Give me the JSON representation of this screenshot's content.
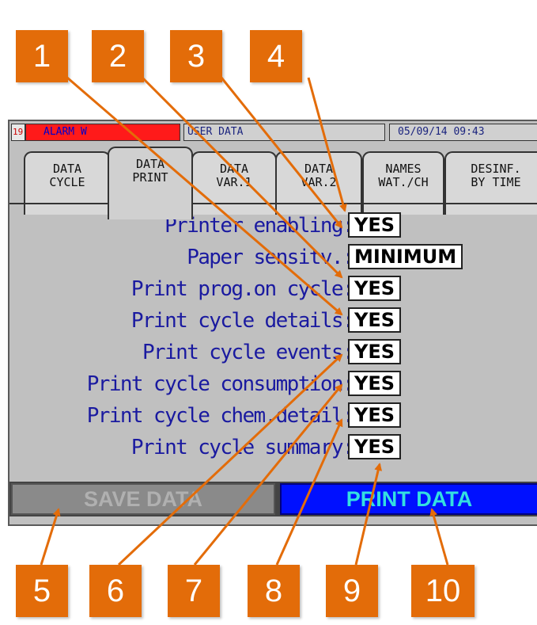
{
  "callouts": [
    "1",
    "2",
    "3",
    "4",
    "5",
    "6",
    "7",
    "8",
    "9",
    "10"
  ],
  "header": {
    "alarm_number": "19",
    "alarm_text": "ALARM W",
    "title": "USER DATA",
    "datetime": "05/09/14  09:43"
  },
  "tabs": [
    {
      "line1": "DATA",
      "line2": "CYCLE",
      "active": false
    },
    {
      "line1": "DATA",
      "line2": "PRINT",
      "active": true
    },
    {
      "line1": "DATA",
      "line2": "VAR.1",
      "active": false
    },
    {
      "line1": "DATA",
      "line2": "VAR.2",
      "active": false
    },
    {
      "line1": "NAMES",
      "line2": "WAT./CH",
      "active": false
    },
    {
      "line1": "DESINF.",
      "line2": "BY TIME",
      "active": false
    }
  ],
  "fields": [
    {
      "label": "Printer enabling:",
      "value": "YES"
    },
    {
      "label": "Paper sensitv.:",
      "value": "MINIMUM"
    },
    {
      "label": "Print prog.on cycle:",
      "value": "YES"
    },
    {
      "label": "Print cycle details:",
      "value": "YES"
    },
    {
      "label": "Print cycle events:",
      "value": "YES"
    },
    {
      "label": "Print cycle consumption:",
      "value": "YES"
    },
    {
      "label": "Print cycle chem.detail:",
      "value": "YES"
    },
    {
      "label": "Print cycle summary:",
      "value": "YES"
    }
  ],
  "buttons": {
    "save": "SAVE DATA",
    "print": "PRINT DATA"
  },
  "colors": {
    "callout": "#e36c09",
    "alarm": "#ff1a1a",
    "print_button": "#0010ff",
    "label_text": "#1a1aa0"
  }
}
